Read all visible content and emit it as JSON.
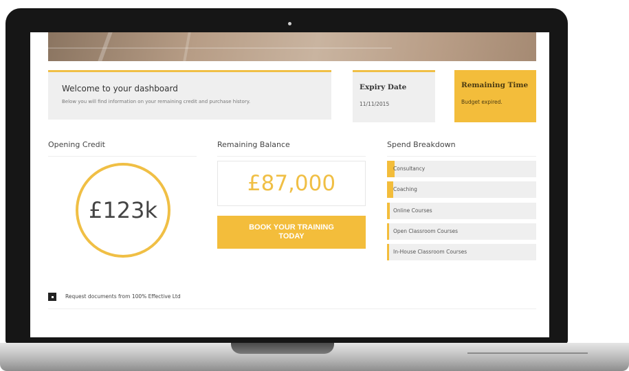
{
  "welcome": {
    "title": "Welcome to your dashboard",
    "subtitle": "Below you will find information on your remaining credit and purchase history."
  },
  "expiry": {
    "label": "Expiry Date",
    "value": "11/11/2015"
  },
  "remaining_time": {
    "label": "Remaining Time",
    "value": "Budget expired."
  },
  "opening_credit": {
    "label": "Opening Credit",
    "value": "£123k"
  },
  "remaining_balance": {
    "label": "Remaining Balance",
    "value": "£87,000",
    "button_label": "BOOK YOUR TRAINING TODAY"
  },
  "spend_breakdown": {
    "label": "Spend Breakdown",
    "items": [
      {
        "label": "Consultancy",
        "fraction": 0.05
      },
      {
        "label": "Coaching",
        "fraction": 0.04
      },
      {
        "label": "Online Courses",
        "fraction": 0.02
      },
      {
        "label": "Open Classroom Courses",
        "fraction": 0.01
      },
      {
        "label": "In-House Classroom Courses",
        "fraction": 0.01
      }
    ]
  },
  "request_documents": {
    "label": "Request documents from 100% Effective Ltd"
  },
  "colors": {
    "accent": "#f3bd3b",
    "card_bg": "#efefef",
    "frame": "#161616"
  }
}
